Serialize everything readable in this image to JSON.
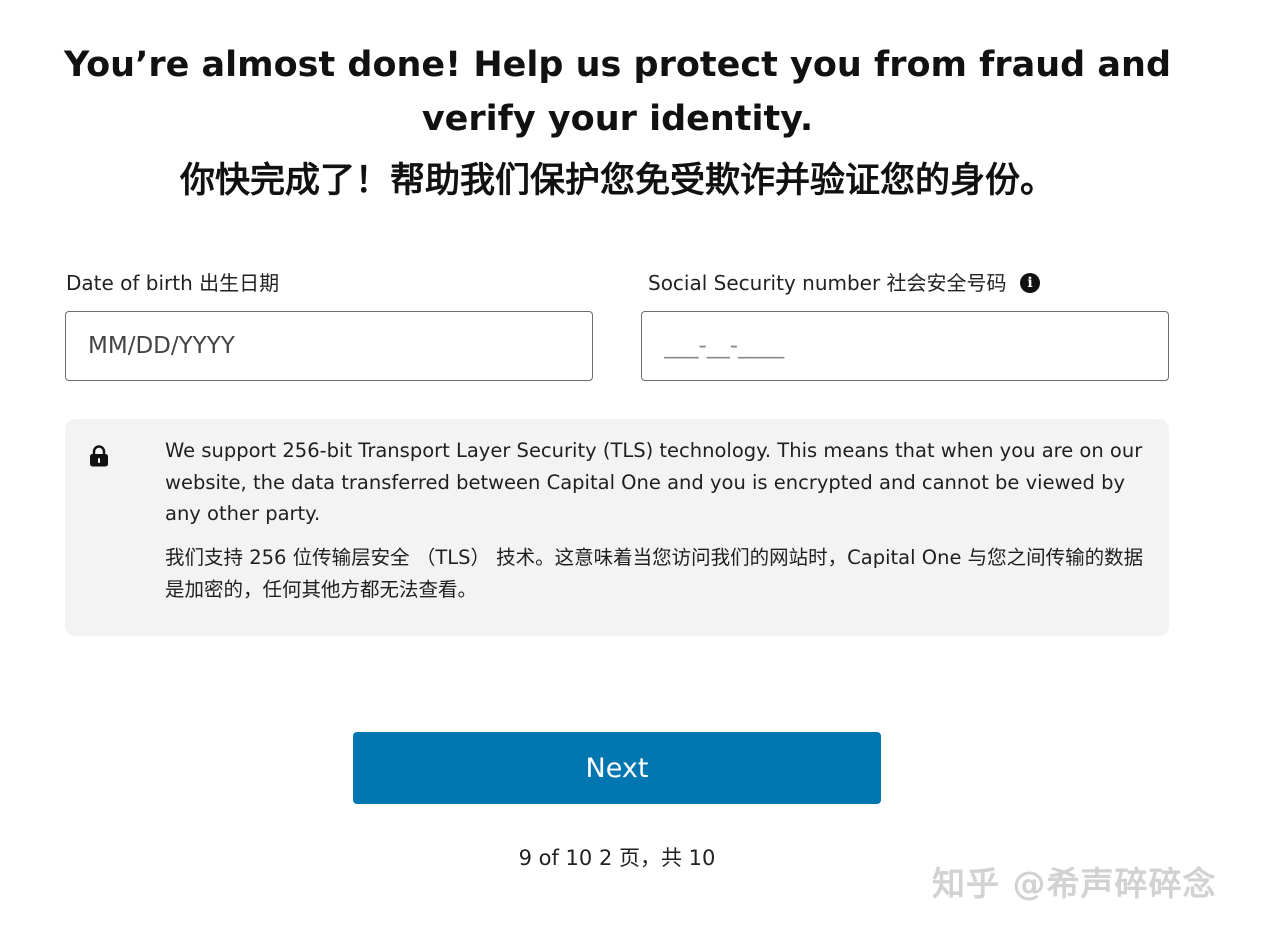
{
  "header": {
    "title_en": "You’re almost done! Help us protect you from fraud and verify your identity.",
    "title_zh": "你快完成了！帮助我们保护您免受欺诈并验证您的身份。"
  },
  "form": {
    "dob": {
      "label": "Date of birth 出生日期",
      "placeholder": "MM/DD/YYYY",
      "value": ""
    },
    "ssn": {
      "label": "Social Security number 社会安全号码",
      "placeholder": "___-__-____",
      "value": "",
      "info_icon": "info-icon"
    }
  },
  "security_notice": {
    "icon": "lock-icon",
    "text_en": "We support 256-bit Transport Layer Security (TLS) technology. This means that when you are on our website, the data transferred between Capital One and you is encrypted and cannot be viewed by any other party.",
    "text_zh": "我们支持 256 位传输层安全 （TLS） 技术。这意味着当您访问我们的网站时，Capital One 与您之间传输的数据是加密的，任何其他方都无法查看。"
  },
  "actions": {
    "next_label": "Next"
  },
  "progress": {
    "text": "9 of 10  2 页，共 10",
    "current": 9,
    "total": 10
  },
  "watermark": {
    "text": "知乎 @希声碎碎念"
  },
  "colors": {
    "primary_button": "#0276b1",
    "notice_background": "#f3f3f3",
    "input_border": "#6d6d6d"
  }
}
